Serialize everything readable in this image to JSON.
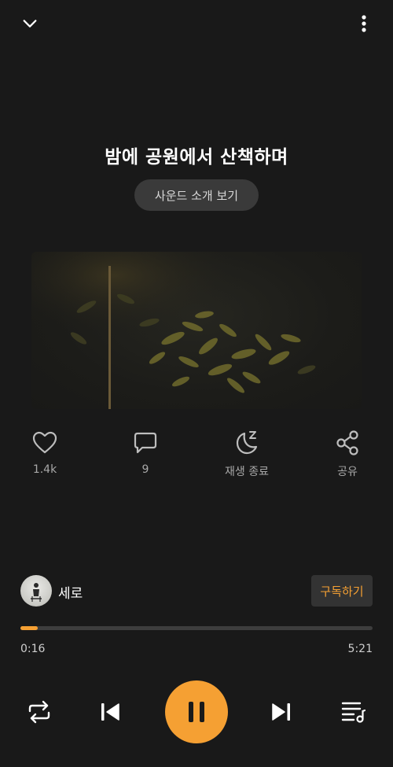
{
  "header": {
    "collapse_icon": "chevron-down-icon",
    "more_icon": "more-vertical-icon"
  },
  "track": {
    "title": "밤에 공원에서 산책하며",
    "intro_label": "사운드 소개 보기"
  },
  "actions": {
    "like": {
      "icon": "heart-icon",
      "label": "1.4k"
    },
    "comment": {
      "icon": "comment-icon",
      "label": "9"
    },
    "sleep": {
      "icon": "moon-sleep-icon",
      "label": "재생 종료"
    },
    "share": {
      "icon": "share-icon",
      "label": "공유"
    }
  },
  "artist": {
    "name": "세로",
    "subscribe_label": "구독하기"
  },
  "player": {
    "current_time": "0:16",
    "total_time": "5:21",
    "progress": 0.05,
    "is_playing": true,
    "controls": [
      "repeat-icon",
      "skip-previous-icon",
      "pause-icon",
      "skip-next-icon",
      "playlist-icon"
    ]
  },
  "colors": {
    "background": "#191919",
    "accent": "#f5a033",
    "muted_text": "#a8a8a8",
    "button_bg": "#3a3a3a"
  }
}
